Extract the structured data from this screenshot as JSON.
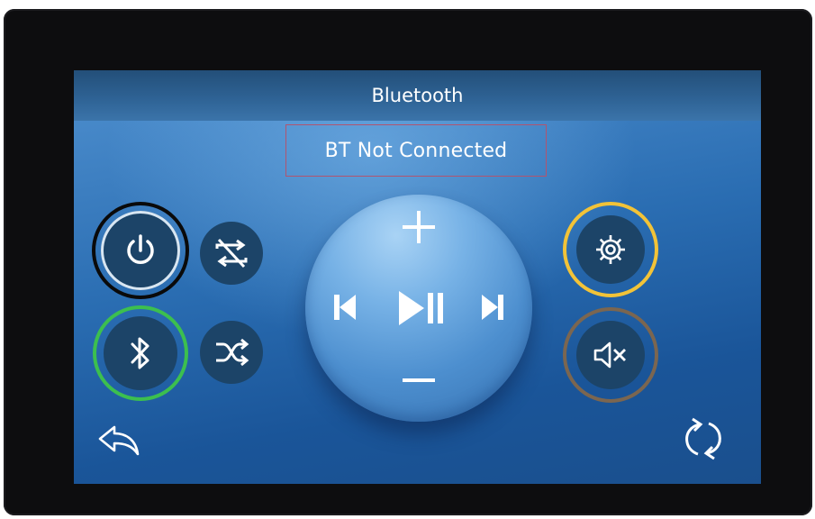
{
  "header": {
    "title": "Bluetooth"
  },
  "status": {
    "text": "BT Not Connected"
  },
  "buttons": {
    "power": "power-icon",
    "repeat_off": "repeat-off-icon",
    "bluetooth": "bluetooth-icon",
    "shuffle": "shuffle-icon",
    "settings": "gear-icon",
    "mute": "mute-icon",
    "back": "back-arrow-icon",
    "refresh": "refresh-icon"
  },
  "dial": {
    "volume_up": "plus-icon",
    "volume_down": "minus-icon",
    "previous": "previous-track-icon",
    "play_pause": "play-pause-icon",
    "next": "next-track-icon"
  },
  "colors": {
    "power_ring": "#0a0a0a",
    "bluetooth_ring": "#3cbf4f",
    "settings_ring": "#f2c338",
    "mute_ring": "#7b6650",
    "status_border": "#b2546f",
    "button_fill": "#1c4468"
  }
}
